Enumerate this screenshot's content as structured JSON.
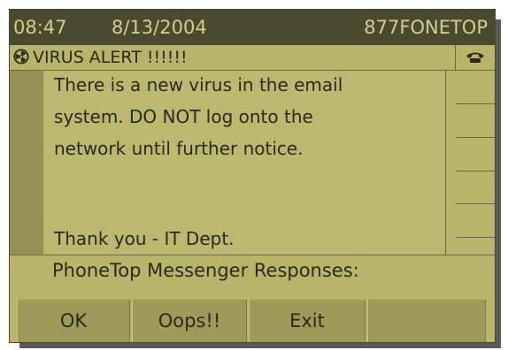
{
  "status": {
    "time": "08:47",
    "date": "8/13/2004",
    "device_id": "877FONETOP"
  },
  "alert": {
    "title": "VIRUS ALERT !!!!!!",
    "icon": "hazard-icon",
    "phone_icon": "phone-icon"
  },
  "message": {
    "lines": [
      "There is a new virus in the email",
      "system.  DO NOT log onto the",
      "network until further notice.",
      "",
      "Thank you - IT Dept."
    ]
  },
  "responses_label": "PhoneTop Messenger Responses:",
  "softkeys": [
    {
      "label": "OK"
    },
    {
      "label": "Oops!!"
    },
    {
      "label": "Exit"
    },
    {
      "label": ""
    }
  ],
  "colors": {
    "screen": "#b8b46a",
    "status_bar": "#4a4a2e",
    "status_text": "#d2cf8c",
    "softkey": "#9e9a5a"
  }
}
